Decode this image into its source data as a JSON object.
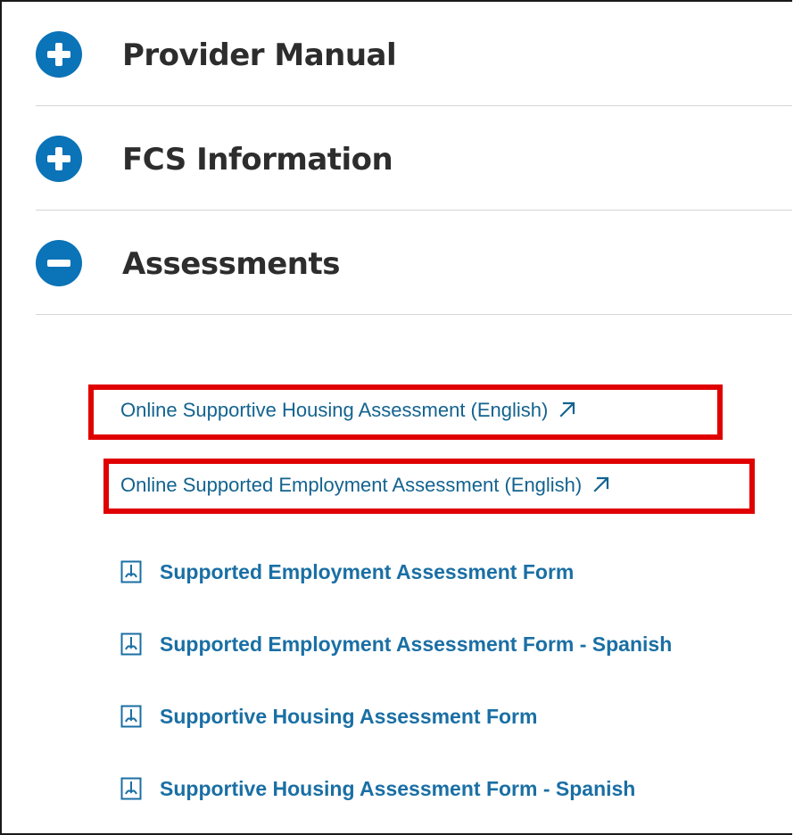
{
  "accordion": {
    "items": [
      {
        "title": "Provider Manual",
        "state": "collapsed",
        "icon": "plus-circle-icon"
      },
      {
        "title": "FCS Information",
        "state": "collapsed",
        "icon": "plus-circle-icon"
      },
      {
        "title": "Assessments",
        "state": "expanded",
        "icon": "minus-circle-icon"
      }
    ]
  },
  "assessments": {
    "external_links": [
      {
        "label": "Online Supportive Housing Assessment (English)",
        "icon": "external-link-icon",
        "highlighted": true
      },
      {
        "label": "Online Supported Employment Assessment (English)",
        "icon": "external-link-icon",
        "highlighted": true
      }
    ],
    "documents": [
      {
        "label": "Supported Employment Assessment Form",
        "icon": "pdf-icon"
      },
      {
        "label": "Supported Employment Assessment Form - Spanish",
        "icon": "pdf-icon"
      },
      {
        "label": "Supportive Housing Assessment Form",
        "icon": "pdf-icon"
      },
      {
        "label": "Supportive Housing Assessment Form - Spanish",
        "icon": "pdf-icon"
      }
    ]
  },
  "colors": {
    "accent": "#0b73b7",
    "link": "#13638f",
    "heading": "#2d2d2d",
    "highlight": "#e00000",
    "divider": "#d6d6d6"
  }
}
